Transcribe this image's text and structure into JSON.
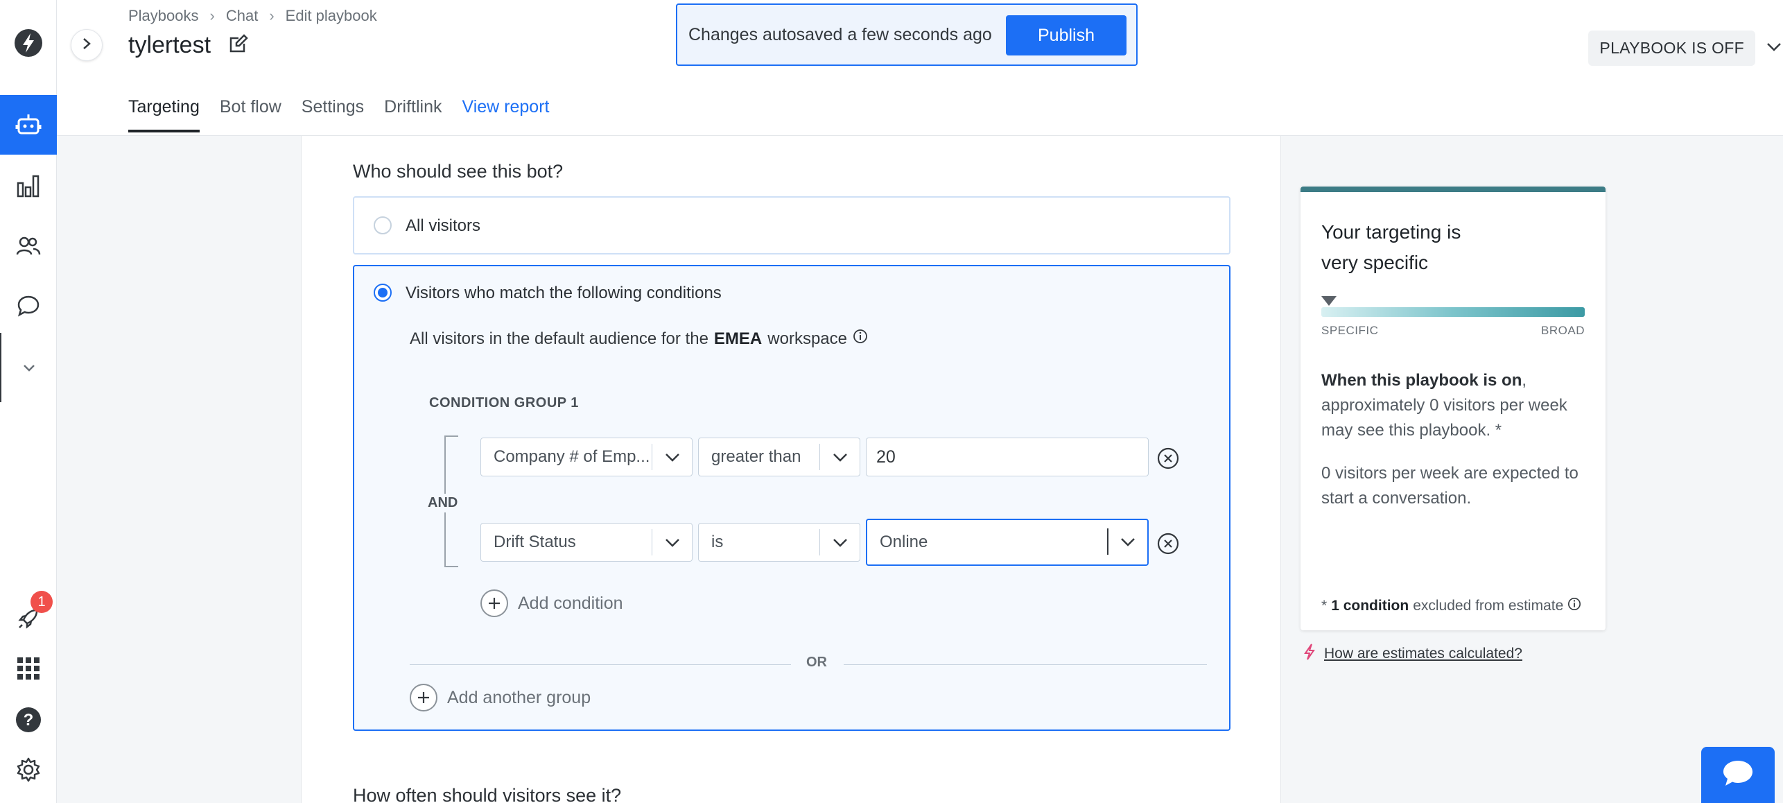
{
  "breadcrumb": {
    "items": [
      "Playbooks",
      "Chat",
      "Edit playbook"
    ]
  },
  "page": {
    "title": "tylertest"
  },
  "tabs": [
    {
      "label": "Targeting"
    },
    {
      "label": "Bot flow"
    },
    {
      "label": "Settings"
    },
    {
      "label": "Driftlink"
    },
    {
      "label": "View report"
    }
  ],
  "status": {
    "label": "PLAYBOOK IS OFF"
  },
  "toast": {
    "text": "Changes autosaved a few seconds ago",
    "publish_label": "Publish"
  },
  "nav": {
    "notification_count": "1"
  },
  "targeting": {
    "question": "Who should see this bot?",
    "option_all": "All visitors",
    "option_match": "Visitors who match the following conditions",
    "audience_prefix": "All visitors in the default audience for the",
    "audience_workspace": "EMEA",
    "audience_suffix": "workspace",
    "group_label": "CONDITION GROUP 1",
    "and_label": "AND",
    "conditions": [
      {
        "field": "Company # of Emp...",
        "operator": "greater than",
        "value": "20"
      },
      {
        "field": "Drift Status",
        "operator": "is",
        "value": "Online"
      }
    ],
    "add_condition": "Add condition",
    "or_label": "OR",
    "add_group": "Add another group",
    "next_question": "How often should visitors see it?"
  },
  "estimate": {
    "title": "Your targeting is very specific",
    "scale_left": "SPECIFIC",
    "scale_right": "BROAD",
    "body_bold": "When this playbook is on",
    "body_rest": ", approximately 0 visitors per week may see this playbook. *",
    "body2": "0 visitors per week are expected to start a conversation.",
    "foot_prefix": "* ",
    "foot_bold": "1 condition",
    "foot_rest": " excluded from estimate",
    "link": "How are estimates calculated?"
  },
  "colors": {
    "accent": "#1c6ff5",
    "teal": "#3c7c86",
    "badge": "#f0504b"
  }
}
